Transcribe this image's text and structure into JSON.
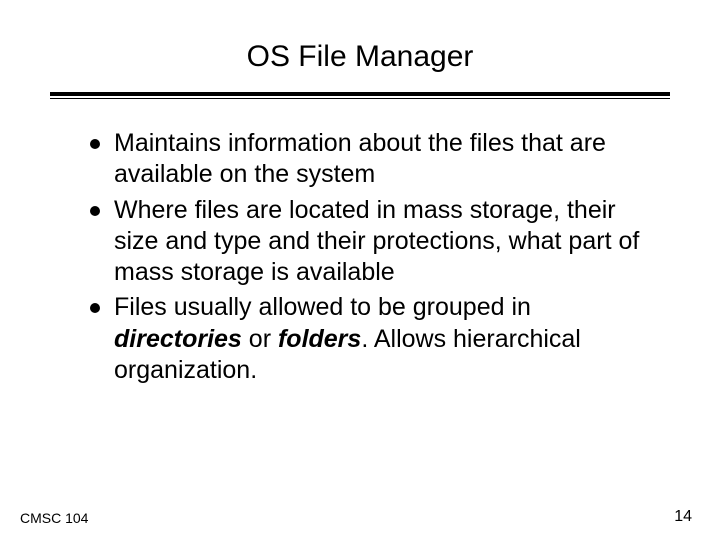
{
  "title": "OS File Manager",
  "bullets": [
    {
      "pre": "Maintains information about the files that are available on the system",
      "em1": "",
      "mid": "",
      "em2": "",
      "post": ""
    },
    {
      "pre": "Where files are located in mass storage, their size and type and their protections, what part of mass storage is available",
      "em1": "",
      "mid": "",
      "em2": "",
      "post": ""
    },
    {
      "pre": "Files usually allowed to be grouped in ",
      "em1": "directories",
      "mid": " or ",
      "em2": "folders",
      "post": ". Allows hierarchical organization."
    }
  ],
  "footer": {
    "left": "CMSC 104",
    "right": "14"
  }
}
